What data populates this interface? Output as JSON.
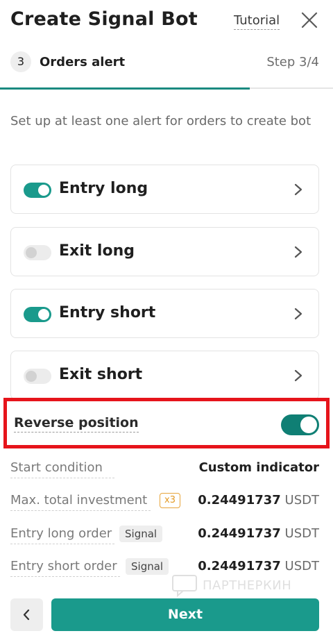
{
  "header": {
    "title": "Create Signal Bot",
    "tutorial_label": "Tutorial"
  },
  "step": {
    "number": "3",
    "label": "Orders alert",
    "count": "Step 3/4",
    "progress_fraction": 0.75
  },
  "intro_text": "Set up at least one alert for orders to create bot",
  "alerts": [
    {
      "label": "Entry long",
      "enabled": true
    },
    {
      "label": "Exit long",
      "enabled": false
    },
    {
      "label": "Entry short",
      "enabled": true
    },
    {
      "label": "Exit short",
      "enabled": false
    }
  ],
  "reverse_position": {
    "label": "Reverse position",
    "enabled": true
  },
  "summary": {
    "start_condition": {
      "label": "Start condition",
      "value": "Custom indicator"
    },
    "max_investment": {
      "label": "Max. total investment",
      "badge": "x3",
      "amount": "0.24491737",
      "unit": "USDT"
    },
    "entry_long_order": {
      "label": "Entry long order",
      "badge": "Signal",
      "amount": "0.24491737",
      "unit": "USDT"
    },
    "entry_short_order": {
      "label": "Entry short order",
      "badge": "Signal",
      "amount": "0.24491737",
      "unit": "USDT"
    }
  },
  "watermark_text": "ПАРТНЕРКИН",
  "footer": {
    "next_label": "Next"
  },
  "colors": {
    "accent": "#1a9a8c",
    "accent_dark": "#0f7f74",
    "highlight_border": "#e6141b",
    "badge_orange": "#e39a25"
  },
  "icons": {
    "close": "close-icon",
    "chevron": "chevron-right-icon",
    "back": "chevron-left-icon"
  }
}
